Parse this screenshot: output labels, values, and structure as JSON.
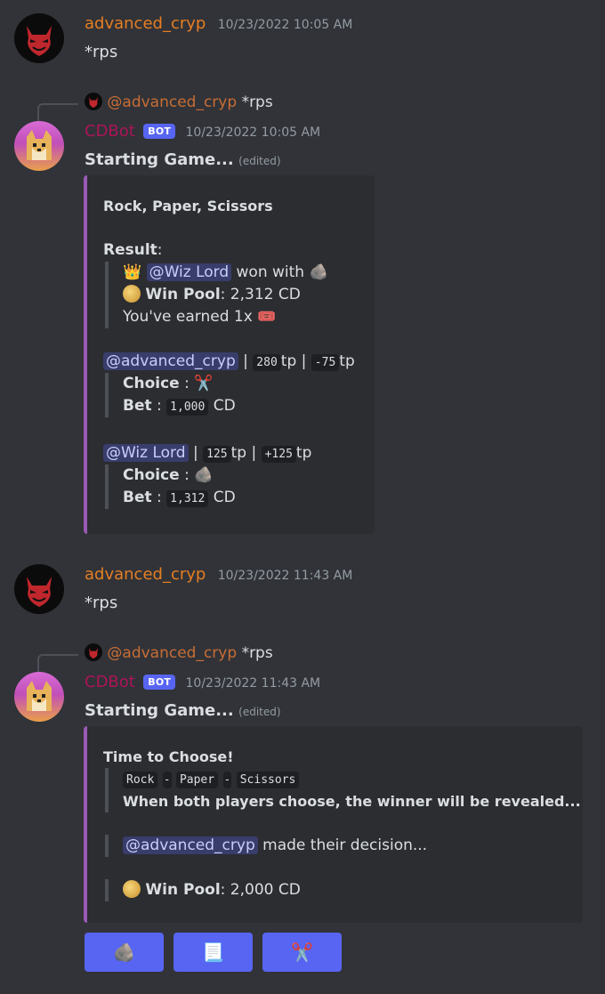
{
  "colors": {
    "background": "#313338",
    "username_orange": "#e67e22",
    "bot_name_pink": "#ad1457",
    "bot_badge": "#5865f2",
    "embed_accent": "#9b59b6",
    "button": "#5865f2"
  },
  "messages": [
    {
      "author": "advanced_cryp",
      "timestamp": "10/23/2022 10:05 AM",
      "text": "*rps"
    },
    {
      "reply": {
        "mention": "@advanced_cryp",
        "text": "*rps"
      },
      "author": "CDBot",
      "badge": "BOT",
      "timestamp": "10/23/2022 10:05 AM",
      "title": "Starting Game...",
      "edited": "(edited)",
      "embed": {
        "title": "Rock, Paper, Scissors",
        "result_label": "Result",
        "colon": ":",
        "winner_mention": "@Wiz Lord",
        "won_with": "won with",
        "win_pool_label": "Win Pool",
        "win_pool_value": ": 2,312 CD",
        "earned": "You've earned 1x",
        "player1": {
          "mention": "@advanced_cryp",
          "sep": "|",
          "tp": "280",
          "tp_unit": "tp",
          "delta": "-75",
          "choice_label": "Choice",
          "choice_icon": "scissors-icon",
          "bet_label": "Bet",
          "bet_value": "1,000",
          "bet_unit": "CD"
        },
        "player2": {
          "mention": "@Wiz Lord",
          "sep": "|",
          "tp": "125",
          "tp_unit": "tp",
          "delta": "+125",
          "choice_label": "Choice",
          "choice_icon": "rock-icon",
          "bet_label": "Bet",
          "bet_value": "1,312",
          "bet_unit": "CD"
        }
      }
    },
    {
      "author": "advanced_cryp",
      "timestamp": "10/23/2022 11:43 AM",
      "text": "*rps"
    },
    {
      "reply": {
        "mention": "@advanced_cryp",
        "text": "*rps"
      },
      "author": "CDBot",
      "badge": "BOT",
      "timestamp": "10/23/2022 11:43 AM",
      "title": "Starting Game...",
      "edited": "(edited)",
      "embed": {
        "title": "Time to Choose!",
        "opt_rock": "Rock",
        "opt_paper": "Paper",
        "opt_scissors": "Scissors",
        "dash": "-",
        "instructions": "When both players choose, the winner will be revealed...",
        "decision_mention": "@advanced_cryp",
        "decision_text": "made their decision...",
        "win_pool_label": "Win Pool",
        "win_pool_value": ": 2,000 CD"
      },
      "buttons": [
        {
          "icon": "rock-icon"
        },
        {
          "icon": "paper-icon"
        },
        {
          "icon": "scissors-icon"
        }
      ]
    }
  ]
}
